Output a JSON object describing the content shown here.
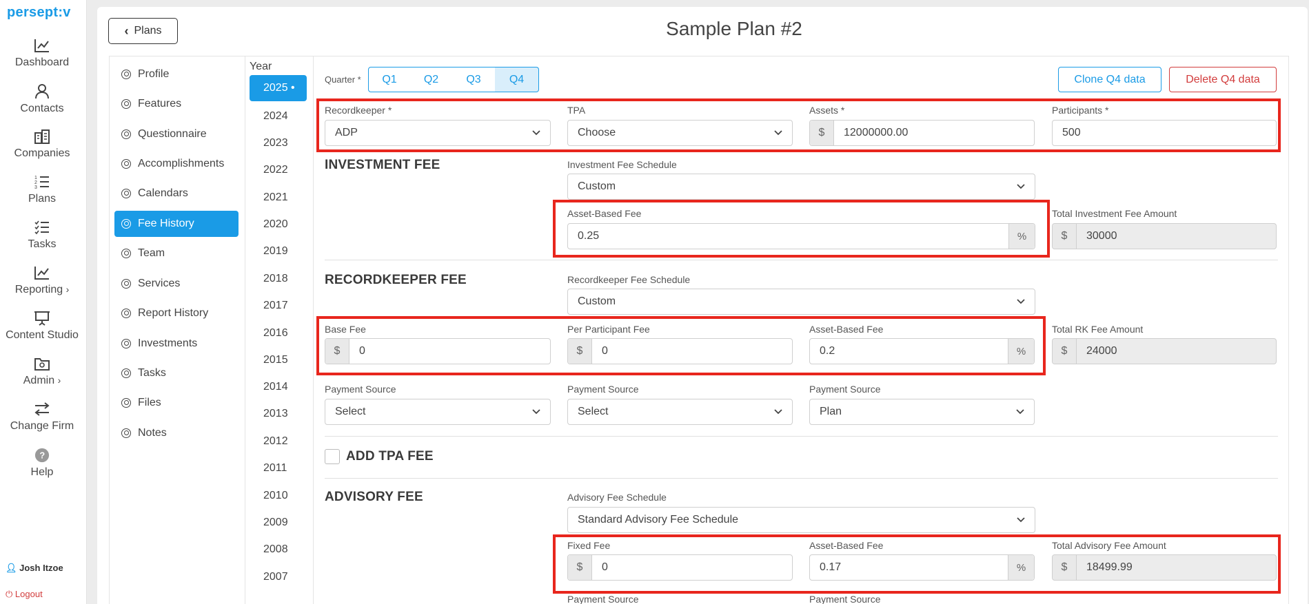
{
  "app": {
    "logo": "persept:v",
    "title": "Sample Plan #2",
    "back_label": "Plans"
  },
  "nav": [
    {
      "label": "Dashboard",
      "icon": "chart-line-icon"
    },
    {
      "label": "Contacts",
      "icon": "user-icon"
    },
    {
      "label": "Companies",
      "icon": "building-icon"
    },
    {
      "label": "Plans",
      "icon": "list-numbered-icon"
    },
    {
      "label": "Tasks",
      "icon": "checklist-icon"
    },
    {
      "label": "Reporting",
      "icon": "chart-line-icon"
    },
    {
      "label": "Content Studio",
      "icon": "presentation-icon"
    },
    {
      "label": "Admin",
      "icon": "folder-gear-icon"
    },
    {
      "label": "Change Firm",
      "icon": "swap-arrows-icon"
    },
    {
      "label": "Help",
      "icon": "help-icon"
    }
  ],
  "user": {
    "name": "Josh Itzoe",
    "logout": "Logout"
  },
  "submenu": [
    "Profile",
    "Features",
    "Questionnaire",
    "Accomplishments",
    "Calendars",
    "Fee History",
    "Team",
    "Services",
    "Report History",
    "Investments",
    "Tasks",
    "Files",
    "Notes"
  ],
  "submenu_active": "Fee History",
  "years": {
    "header": "Year",
    "active": "2025 •",
    "list": [
      "2024",
      "2023",
      "2022",
      "2021",
      "2020",
      "2019",
      "2018",
      "2017",
      "2016",
      "2015",
      "2014",
      "2013",
      "2012",
      "2011",
      "2010",
      "2009",
      "2008",
      "2007"
    ]
  },
  "quarter": {
    "label": "Quarter *",
    "options": [
      "Q1",
      "Q2",
      "Q3",
      "Q4"
    ],
    "active": "Q4"
  },
  "actions": {
    "clone": "Clone Q4 data",
    "delete": "Delete Q4 data"
  },
  "top_fields": {
    "recordkeeper": {
      "label": "Recordkeeper *",
      "value": "ADP"
    },
    "tpa": {
      "label": "TPA",
      "value": "Choose"
    },
    "assets": {
      "label": "Assets *",
      "prefix": "$",
      "value": "12000000.00"
    },
    "participants": {
      "label": "Participants *",
      "value": "500"
    }
  },
  "investment_fee": {
    "title": "INVESTMENT FEE",
    "schedule_label": "Investment Fee Schedule",
    "schedule_value": "Custom",
    "asset_fee_label": "Asset-Based Fee",
    "asset_fee_value": "0.25",
    "asset_fee_suffix": "%",
    "total_label": "Total Investment Fee Amount",
    "total_prefix": "$",
    "total_value": "30000"
  },
  "recordkeeper_fee": {
    "title": "RECORDKEEPER FEE",
    "schedule_label": "Recordkeeper Fee Schedule",
    "schedule_value": "Custom",
    "base_label": "Base Fee",
    "base_prefix": "$",
    "base_value": "0",
    "per_label": "Per Participant Fee",
    "per_prefix": "$",
    "per_value": "0",
    "asset_label": "Asset-Based Fee",
    "asset_value": "0.2",
    "asset_suffix": "%",
    "total_label": "Total RK Fee Amount",
    "total_prefix": "$",
    "total_value": "24000",
    "payment_label": "Payment Source",
    "payment_values": [
      "Select",
      "Select",
      "Plan"
    ]
  },
  "tpa_fee": {
    "title": "ADD TPA FEE"
  },
  "advisory_fee": {
    "title": "ADVISORY FEE",
    "schedule_label": "Advisory Fee Schedule",
    "schedule_value": "Standard Advisory Fee Schedule",
    "fixed_label": "Fixed Fee",
    "fixed_prefix": "$",
    "fixed_value": "0",
    "asset_label": "Asset-Based Fee",
    "asset_value": "0.17",
    "asset_suffix": "%",
    "total_label": "Total Advisory Fee Amount",
    "total_prefix": "$",
    "total_value": "18499.99",
    "payment_label": "Payment Source"
  },
  "colors": {
    "accent": "#1a9be6",
    "danger": "#d23c3c",
    "highlight": "#e8261d"
  }
}
